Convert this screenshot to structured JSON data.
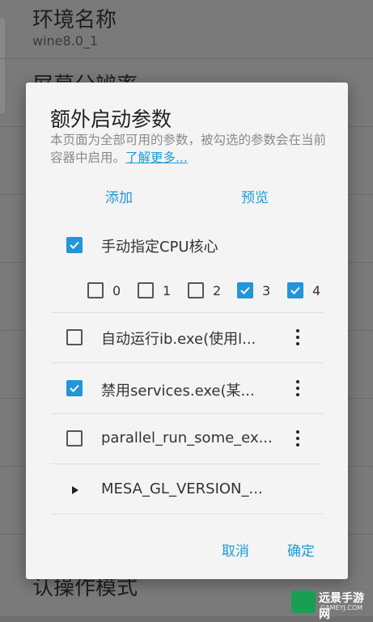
{
  "background": {
    "env_name_title": "环境名称",
    "env_name_value": "wine8.0_1",
    "resolution_title": "屏幕分辨率",
    "operation_mode_title": "认操作模式"
  },
  "dialog": {
    "title": "额外启动参数",
    "description": "本页面为全部可用的参数，被勾选的参数会在当前容器中启用。",
    "learn_more": "了解更多...",
    "tabs": {
      "add": "添加",
      "preview": "预览"
    },
    "cpu_option": {
      "label": "手动指定CPU核心",
      "checked": true,
      "cores": [
        {
          "label": "0",
          "checked": false
        },
        {
          "label": "1",
          "checked": false
        },
        {
          "label": "2",
          "checked": false
        },
        {
          "label": "3",
          "checked": true
        },
        {
          "label": "4",
          "checked": true
        }
      ]
    },
    "options": [
      {
        "label": "自动运行ib.exe(使用l...",
        "checked": false
      },
      {
        "label": "禁用services.exe(某...",
        "checked": true
      },
      {
        "label": "parallel_run_some_ex...",
        "checked": false
      }
    ],
    "expandable": {
      "label": "MESA_GL_VERSION_..."
    },
    "buttons": {
      "cancel": "取消",
      "ok": "确定"
    }
  },
  "watermark": {
    "brand": "远景手游网",
    "url": "GAMEYJ.COM"
  },
  "colors": {
    "accent": "#2196d8",
    "link": "#1e9bd7"
  }
}
